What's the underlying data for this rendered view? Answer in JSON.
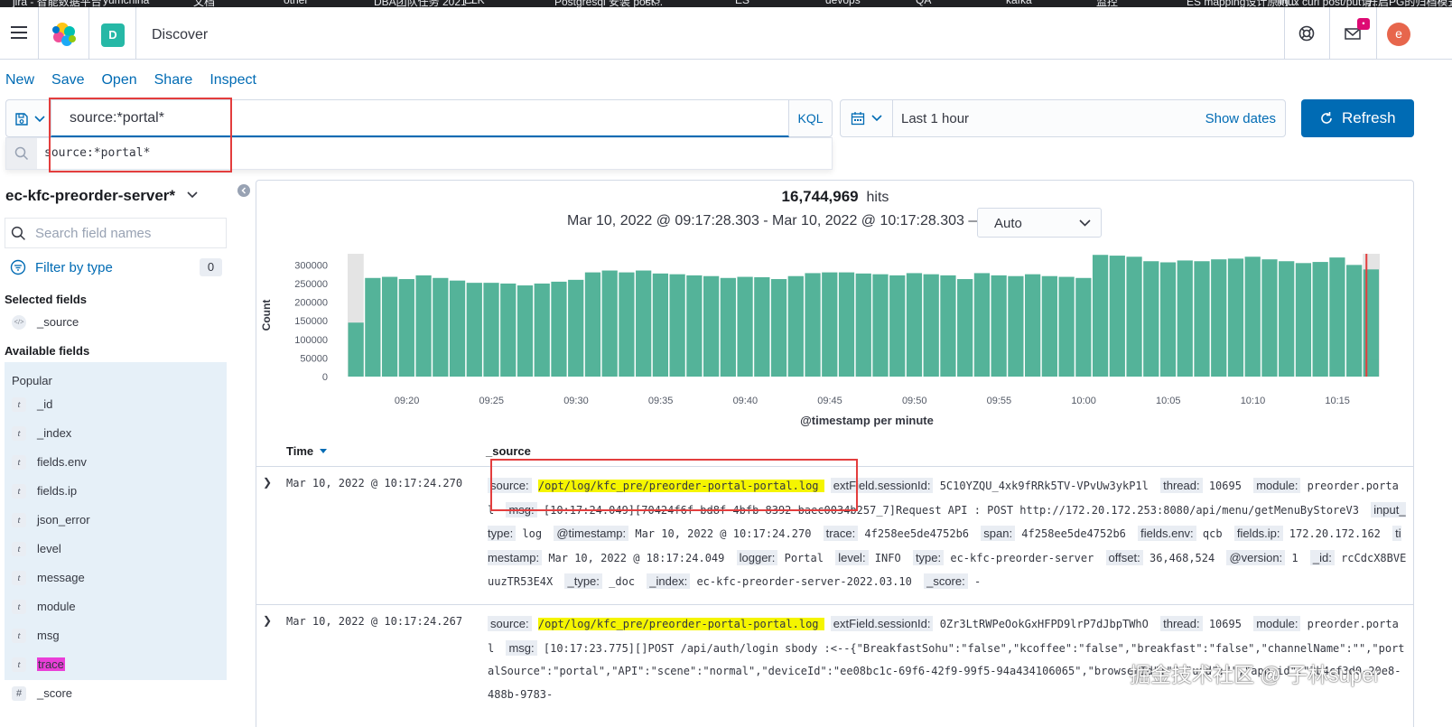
{
  "bookmarks": [
    "jira - 智能数据平台",
    "yumchina",
    "文档",
    "other",
    "DBA团队任务 2021 -",
    "ELK",
    "Postgresql 安装 post...",
    "PG",
    "ES",
    "devops",
    "QA",
    "kafka",
    "监控",
    "ES mapping设计原则...",
    "linux curl post/put请...",
    "开启PG的归档模式 - ..."
  ],
  "header": {
    "space_letter": "D",
    "app_title": "Discover",
    "mail_badge": "•",
    "user_initial": "e"
  },
  "topnav": [
    "New",
    "Save",
    "Open",
    "Share",
    "Inspect"
  ],
  "query": {
    "value": "source:*portal*",
    "language": "KQL",
    "suggestion": "source:*portal*"
  },
  "date": {
    "range": "Last 1 hour",
    "show_dates": "Show dates",
    "refresh": "Refresh"
  },
  "sidebar": {
    "index_pattern": "ec-kfc-preorder-server*",
    "search_placeholder": "Search field names",
    "filter_by_type": "Filter by type",
    "filter_count": "0",
    "selected_title": "Selected fields",
    "selected_fields": [
      {
        "type": "</>",
        "name": "_source"
      }
    ],
    "available_title": "Available fields",
    "popular_label": "Popular",
    "popular_fields": [
      {
        "type": "t",
        "name": "_id"
      },
      {
        "type": "t",
        "name": "_index"
      },
      {
        "type": "t",
        "name": "fields.env"
      },
      {
        "type": "t",
        "name": "fields.ip"
      },
      {
        "type": "t",
        "name": "json_error"
      },
      {
        "type": "t",
        "name": "level"
      },
      {
        "type": "t",
        "name": "message"
      },
      {
        "type": "t",
        "name": "module"
      },
      {
        "type": "t",
        "name": "msg"
      },
      {
        "type": "t",
        "name": "trace"
      }
    ],
    "other_fields": [
      {
        "type": "#",
        "name": "_score"
      }
    ]
  },
  "hits": {
    "count": "16,744,969",
    "label": "hits"
  },
  "time_range": "Mar 10, 2022 @ 09:17:28.303 - Mar 10, 2022 @ 10:17:28.303 —",
  "interval": "Auto",
  "chart_data": {
    "type": "bar",
    "xlabel": "@timestamp per minute",
    "ylabel": "Count",
    "ylim": [
      0,
      330000
    ],
    "yticks": [
      "300000",
      "250000",
      "200000",
      "150000",
      "100000",
      "50000",
      "0"
    ],
    "ytick_values": [
      300000,
      250000,
      200000,
      150000,
      100000,
      50000,
      0
    ],
    "xticks": [
      "09:20",
      "09:25",
      "09:30",
      "09:35",
      "09:40",
      "09:45",
      "09:50",
      "09:55",
      "10:00",
      "10:05",
      "10:10",
      "10:15"
    ],
    "xtick_minutes": [
      20,
      25,
      30,
      35,
      40,
      45,
      50,
      55,
      60,
      65,
      70,
      75
    ],
    "start_minute": 17,
    "minutes": [
      17,
      18,
      19,
      20,
      21,
      22,
      23,
      24,
      25,
      26,
      27,
      28,
      29,
      30,
      31,
      32,
      33,
      34,
      35,
      36,
      37,
      38,
      39,
      40,
      41,
      42,
      43,
      44,
      45,
      46,
      47,
      48,
      49,
      50,
      51,
      52,
      53,
      54,
      55,
      56,
      57,
      58,
      59,
      60,
      61,
      62,
      63,
      64,
      65,
      66,
      67,
      68,
      69,
      70,
      71,
      72,
      73,
      74,
      75,
      76,
      77
    ],
    "values": [
      145000,
      265000,
      268000,
      262000,
      272000,
      265000,
      258000,
      252000,
      252000,
      250000,
      245000,
      250000,
      255000,
      260000,
      280000,
      285000,
      280000,
      285000,
      277000,
      275000,
      272000,
      270000,
      265000,
      268000,
      267000,
      262000,
      270000,
      278000,
      280000,
      280000,
      277000,
      275000,
      272000,
      278000,
      275000,
      272000,
      262000,
      278000,
      272000,
      270000,
      275000,
      270000,
      268000,
      265000,
      327000,
      325000,
      322000,
      310000,
      307000,
      312000,
      310000,
      315000,
      317000,
      322000,
      315000,
      310000,
      305000,
      308000,
      320000,
      300000,
      288000
    ],
    "partial_values": [
      45000
    ],
    "bar_color": "#54b399"
  },
  "table": {
    "time_header": "Time",
    "source_header": "_source",
    "rows": [
      {
        "time": "Mar 10, 2022 @ 10:17:24.270",
        "fields": [
          {
            "k": "source:",
            "v": "/opt/log/kfc_pre/preorder-portal-portal.log",
            "hl": true
          },
          {
            "k": "extField.sessionId:",
            "v": "5C10YZQU_4xk9fRRk5TV-VPvUw3ykP1l"
          },
          {
            "k": "thread:",
            "v": "10695"
          },
          {
            "k": "module:",
            "v": "preorder.portal"
          },
          {
            "k": "msg:",
            "v": "[10:17:24.049][70424f6f-bd8f-4bfb-8392-baec0034b257_7]Request API : POST http://172.20.172.253:8080/api/menu/getMenuByStoreV3"
          },
          {
            "k": "input_type:",
            "v": "log"
          },
          {
            "k": "@timestamp:",
            "v": "Mar 10, 2022 @ 10:17:24.270"
          },
          {
            "k": "trace:",
            "v": "4f258ee5de4752b6"
          },
          {
            "k": "span:",
            "v": "4f258ee5de4752b6"
          },
          {
            "k": "fields.env:",
            "v": "qcb"
          },
          {
            "k": "fields.ip:",
            "v": "172.20.172.162"
          },
          {
            "k": "timestamp:",
            "v": "Mar 10, 2022 @ 18:17:24.049"
          },
          {
            "k": "logger:",
            "v": "Portal"
          },
          {
            "k": "level:",
            "v": "INFO"
          },
          {
            "k": "type:",
            "v": "ec-kfc-preorder-server"
          },
          {
            "k": "offset:",
            "v": "36,468,524"
          },
          {
            "k": "@version:",
            "v": "1"
          },
          {
            "k": "_id:",
            "v": "rcCdcX8BVEuuzTR53E4X"
          },
          {
            "k": "_type:",
            "v": "_doc"
          },
          {
            "k": "_index:",
            "v": "ec-kfc-preorder-server-2022.03.10"
          },
          {
            "k": "_score:",
            "v": "-"
          }
        ]
      },
      {
        "time": "Mar 10, 2022 @ 10:17:24.267",
        "fields": [
          {
            "k": "source:",
            "v": "/opt/log/kfc_pre/preorder-portal-portal.log",
            "hl": true
          },
          {
            "k": "extField.sessionId:",
            "v": "0Zr3LtRWPeOokGxHFPD9lrP7dJbpTWhO"
          },
          {
            "k": "thread:",
            "v": "10695"
          },
          {
            "k": "module:",
            "v": "preorder.portal"
          },
          {
            "k": "msg:",
            "v": "[10:17:23.775][]POST /api/auth/login sbody :<--{\"BreakfastSohu\":\"false\",\"kcoffee\":\"false\",\"breakfast\":\"false\",\"channelName\":\"\",\"portalSource\":\"portal\",\"API\":\"scene\":\"normal\",\"deviceId\":\"ee08bc1c-69f6-42f9-99f5-94a434106065\",\"browserId\":\"\",\"uid\":\"\",\"app_id\":\"3b4cf3d0-20e8-488b-9783-"
          }
        ]
      }
    ]
  },
  "watermark": "掘金技术社区 @ 子林super"
}
